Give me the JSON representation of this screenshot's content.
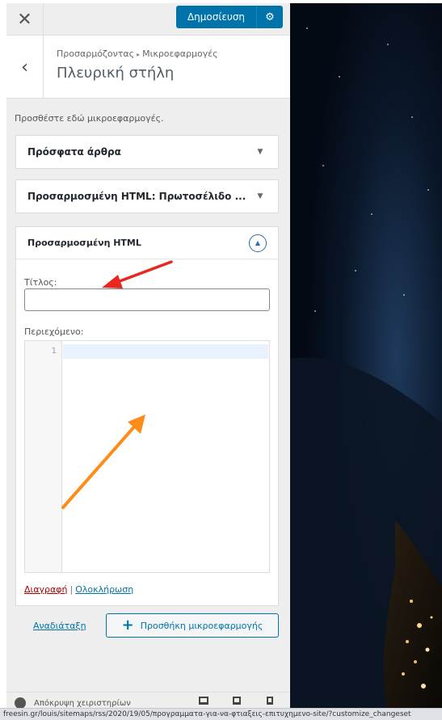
{
  "header": {
    "publish_label": "Δημοσίευση"
  },
  "section": {
    "breadcrumb_parent": "Προσαρμόζοντας",
    "breadcrumb_child": "Μικροεφαρμογές",
    "title": "Πλευρική στήλη"
  },
  "intro_text": "Προσθέστε εδώ μικροεφαρμογές.",
  "widgets": [
    {
      "title": "Πρόσφατα άρθρα"
    },
    {
      "title": "Προσαρμοσμένη HTML: Πρωτοσέλιδο ..."
    },
    {
      "title": "Προσαρμοσμένη HTML",
      "title_label": "Τίτλος:",
      "title_value": "",
      "content_label": "Περιεχόμενο:",
      "line_number": "1",
      "delete_label": "Διαγραφή",
      "separator": "|",
      "done_label": "Ολοκλήρωση"
    }
  ],
  "reorder_label": "Αναδιάταξη",
  "add_widget_label": "Προσθήκη μικροεφαρμογής",
  "footer": {
    "hide_controls_label": "Απόκρυψη χειριστηρίων"
  },
  "status_bar_url": "freesin.gr/louis/sitemaps/rss/2020/19/05/προγραμματα-για-να-φτιαξεις-επιτυχημενο-site/?customize_changeset",
  "annotations": {
    "red_arrow_color": "#e8281e",
    "orange_arrow_color": "#ff8c1a"
  }
}
